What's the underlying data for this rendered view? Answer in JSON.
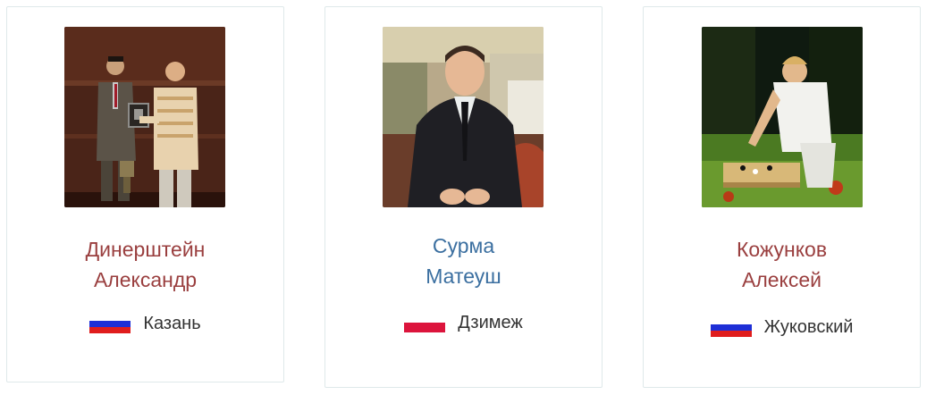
{
  "players": [
    {
      "first_line": "Динерштейн",
      "second_line": "Александр",
      "city": "Казань",
      "flag": "russia-flag",
      "name_color": "#9a3f3f"
    },
    {
      "first_line": "Сурма",
      "second_line": "Матеуш",
      "city": "Дзимеж",
      "flag": "poland-flag",
      "name_color": "#3b6fa0"
    },
    {
      "first_line": "Кожунков",
      "second_line": "Алексей",
      "city": "Жуковский",
      "flag": "russia-flag",
      "name_color": "#9a3f3f"
    }
  ]
}
